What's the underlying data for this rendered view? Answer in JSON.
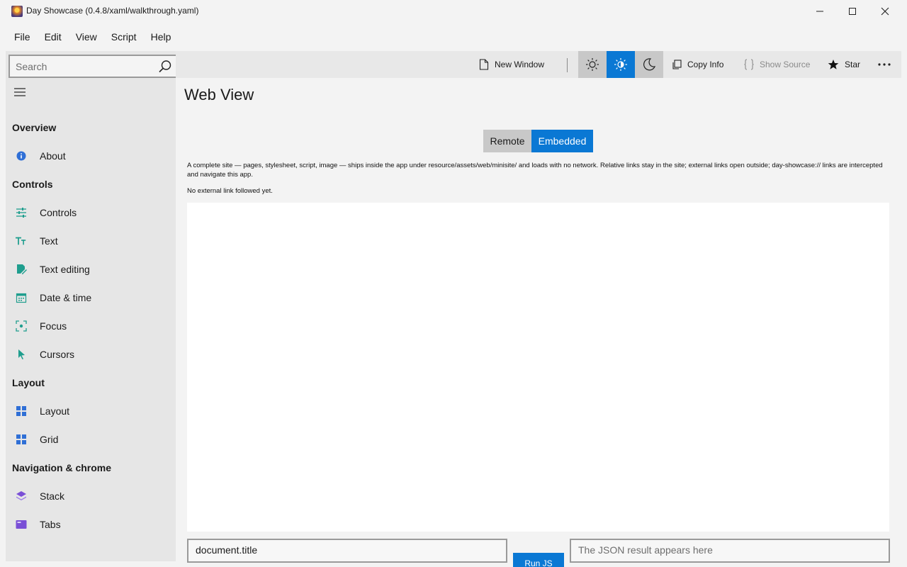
{
  "window": {
    "title": "Day Showcase (0.4.8/xaml/walkthrough.yaml)",
    "app_icon": "day-showcase-logo-icon"
  },
  "menu": [
    "File",
    "Edit",
    "View",
    "Script",
    "Help"
  ],
  "search": {
    "placeholder": "Search"
  },
  "sidebar": {
    "sections": [
      {
        "header": "Overview",
        "items": [
          {
            "label": "About",
            "icon": "info-icon"
          }
        ]
      },
      {
        "header": "Controls",
        "items": [
          {
            "label": "Controls",
            "icon": "sliders-icon"
          },
          {
            "label": "Text",
            "icon": "text-size-icon"
          },
          {
            "label": "Text editing",
            "icon": "edit-document-icon"
          },
          {
            "label": "Date & time",
            "icon": "calendar-icon"
          },
          {
            "label": "Focus",
            "icon": "focus-icon"
          },
          {
            "label": "Cursors",
            "icon": "cursor-icon"
          }
        ]
      },
      {
        "header": "Layout",
        "items": [
          {
            "label": "Layout",
            "icon": "layout-grid-icon"
          },
          {
            "label": "Grid",
            "icon": "grid-icon"
          }
        ]
      },
      {
        "header": "Navigation & chrome",
        "items": [
          {
            "label": "Stack",
            "icon": "stack-icon"
          },
          {
            "label": "Tabs",
            "icon": "tabs-icon"
          }
        ]
      }
    ]
  },
  "toolbar": {
    "new_window": "New Window",
    "copy_info": "Copy Info",
    "show_source": "Show Source",
    "star": "Star",
    "theme_selected": "light-high-contrast"
  },
  "main": {
    "title": "Web View",
    "segments": [
      "Remote",
      "Embedded"
    ],
    "selected_segment": "Embedded",
    "description": "A complete site — pages, stylesheet, script, image — ships inside the app under resource/assets/web/minisite/ and loads with no network. Relative links stay in the site; external links open outside; day-showcase:// links are intercepted and navigate this app.",
    "status": "No external link followed yet.",
    "expression_value": "document.title",
    "run_label": "Run JS",
    "result_placeholder": "The JSON result appears here"
  },
  "colors": {
    "accent": "#0a78d4",
    "sidebar_bg": "#e6e6e6",
    "icon_teal": "#1f9e8e",
    "icon_purple": "#7a4fd6"
  }
}
